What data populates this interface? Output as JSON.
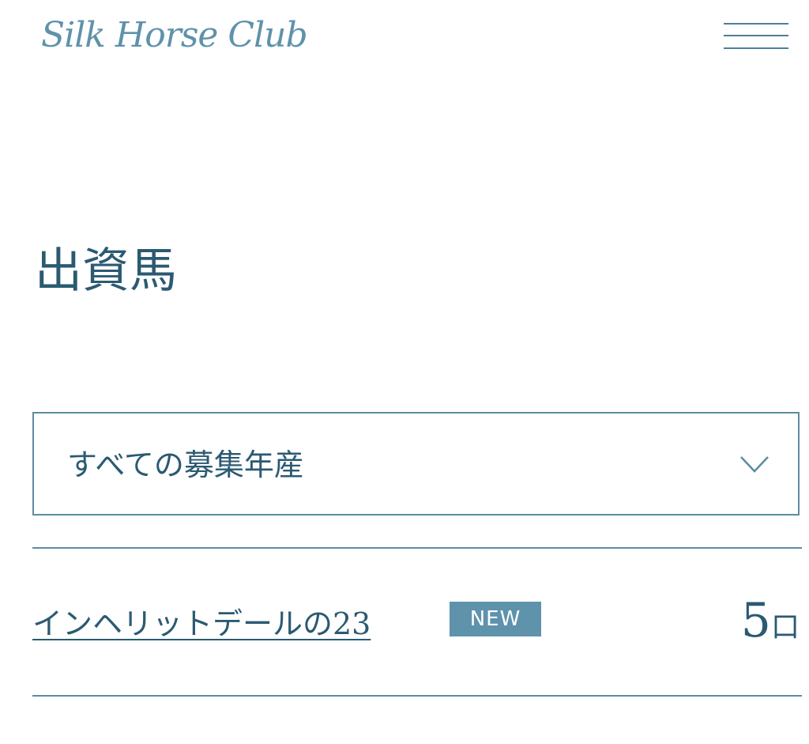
{
  "header": {
    "logo_text": "Silk Horse Club",
    "menu_icon": "hamburger-menu-icon"
  },
  "page": {
    "title": "出資馬"
  },
  "filter": {
    "selected_value": "すべての募集年産",
    "icon": "chevron-down-icon"
  },
  "horses": [
    {
      "name": "インヘリットデールの23",
      "badge": "NEW",
      "units_number": "5",
      "units_suffix": "口"
    }
  ],
  "colors": {
    "primary_text": "#2b5a72",
    "accent": "#5f92ab",
    "border": "#5c8ca3",
    "background": "#ffffff"
  }
}
